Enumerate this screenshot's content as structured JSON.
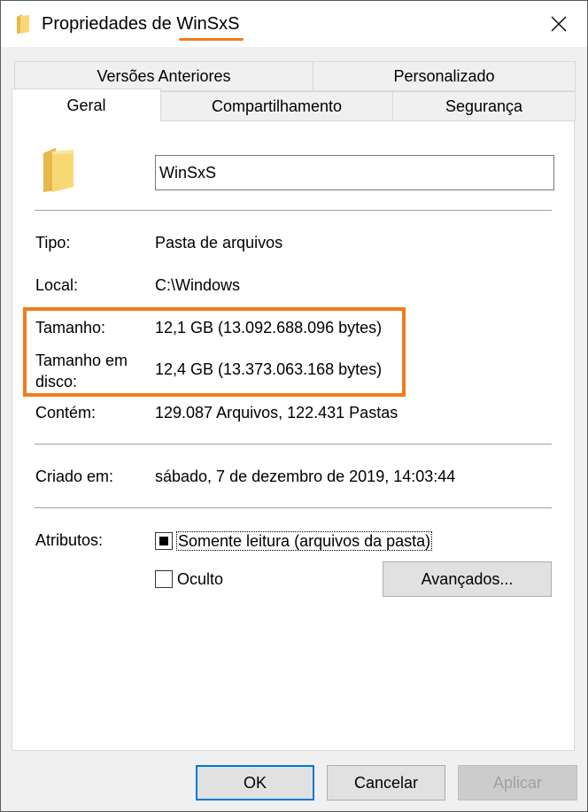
{
  "window": {
    "title_prefix": "Propriedades de ",
    "title_name": "WinSxS"
  },
  "tabs": {
    "previous_versions": "Versões Anteriores",
    "customize": "Personalizado",
    "general": "Geral",
    "sharing": "Compartilhamento",
    "security": "Segurança"
  },
  "general": {
    "folder_name": "WinSxS",
    "type_label": "Tipo:",
    "type_value": "Pasta de arquivos",
    "location_label": "Local:",
    "location_value": "C:\\Windows",
    "size_label": "Tamanho:",
    "size_value": "12,1 GB (13.092.688.096 bytes)",
    "size_on_disk_label_line1": "Tamanho em",
    "size_on_disk_label_line2": "disco:",
    "size_on_disk_value": "12,4 GB (13.373.063.168 bytes)",
    "contains_label": "Contém:",
    "contains_value": "129.087 Arquivos, 122.431 Pastas",
    "created_label": "Criado em:",
    "created_value": "sábado, 7 de dezembro de 2019, 14:03:44",
    "attributes_label": "Atributos:",
    "readonly_label": "Somente leitura (arquivos da pasta)",
    "hidden_label": "Oculto",
    "advanced_button": "Avançados..."
  },
  "footer": {
    "ok": "OK",
    "cancel": "Cancelar",
    "apply": "Aplicar"
  },
  "colors": {
    "highlight": "#f07c1e",
    "folder": "#f8d775",
    "primary_border": "#0078d7"
  },
  "icons": {
    "title": "folder-icon",
    "close": "close-icon",
    "folder": "folder-icon"
  },
  "state": {
    "readonly_checked": "indeterminate",
    "hidden_checked": false,
    "apply_enabled": false
  }
}
